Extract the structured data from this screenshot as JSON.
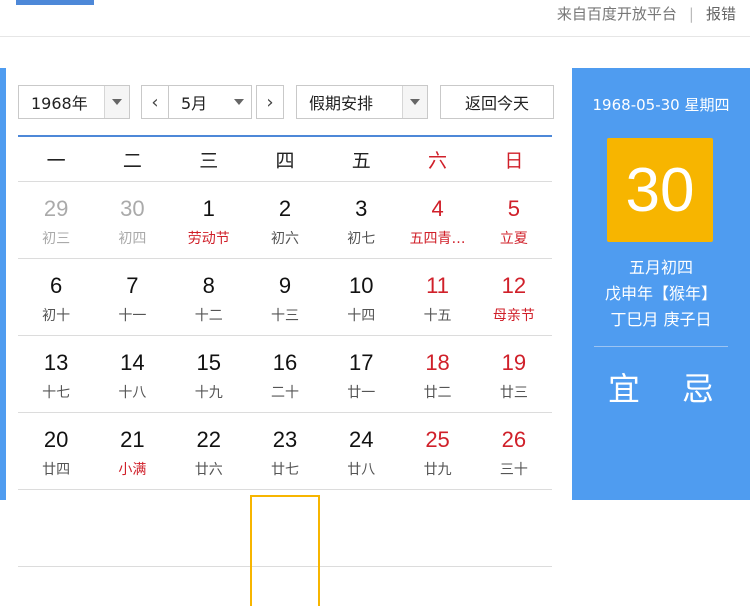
{
  "header": {
    "source_text": "来自百度开放平台",
    "separator": "|",
    "report_label": "报错"
  },
  "controls": {
    "year": "1968年",
    "prev_month_icon": "‹",
    "month": "5月",
    "next_month_icon": "›",
    "holiday": "假期安排",
    "today_button": "返回今天"
  },
  "weekdays": [
    "一",
    "二",
    "三",
    "四",
    "五",
    "六",
    "日"
  ],
  "weeks": [
    [
      {
        "num": "29",
        "lunar": "初三",
        "other": true
      },
      {
        "num": "30",
        "lunar": "初四",
        "other": true
      },
      {
        "num": "1",
        "lunar": "劳动节",
        "lunar_red": true
      },
      {
        "num": "2",
        "lunar": "初六"
      },
      {
        "num": "3",
        "lunar": "初七"
      },
      {
        "num": "4",
        "lunar": "五四青…",
        "num_red": true,
        "lunar_red": true
      },
      {
        "num": "5",
        "lunar": "立夏",
        "num_red": true,
        "lunar_red": true
      }
    ],
    [
      {
        "num": "6",
        "lunar": "初十"
      },
      {
        "num": "7",
        "lunar": "十一"
      },
      {
        "num": "8",
        "lunar": "十二"
      },
      {
        "num": "9",
        "lunar": "十三"
      },
      {
        "num": "10",
        "lunar": "十四"
      },
      {
        "num": "11",
        "lunar": "十五",
        "num_red": true
      },
      {
        "num": "12",
        "lunar": "母亲节",
        "num_red": true,
        "lunar_red": true
      }
    ],
    [
      {
        "num": "13",
        "lunar": "十七"
      },
      {
        "num": "14",
        "lunar": "十八"
      },
      {
        "num": "15",
        "lunar": "十九"
      },
      {
        "num": "16",
        "lunar": "二十"
      },
      {
        "num": "17",
        "lunar": "廿一"
      },
      {
        "num": "18",
        "lunar": "廿二",
        "num_red": true
      },
      {
        "num": "19",
        "lunar": "廿三",
        "num_red": true
      }
    ],
    [
      {
        "num": "20",
        "lunar": "廿四"
      },
      {
        "num": "21",
        "lunar": "小满",
        "lunar_red": true
      },
      {
        "num": "22",
        "lunar": "廿六"
      },
      {
        "num": "23",
        "lunar": "廿七"
      },
      {
        "num": "24",
        "lunar": "廿八"
      },
      {
        "num": "25",
        "lunar": "廿九",
        "num_red": true
      },
      {
        "num": "26",
        "lunar": "三十",
        "num_red": true
      }
    ],
    [
      {
        "num": "",
        "lunar": ""
      },
      {
        "num": "",
        "lunar": ""
      },
      {
        "num": "",
        "lunar": ""
      },
      {
        "num": "",
        "lunar": "",
        "selected": true
      },
      {
        "num": "",
        "lunar": ""
      },
      {
        "num": "",
        "lunar": ""
      },
      {
        "num": "",
        "lunar": ""
      }
    ]
  ],
  "side": {
    "date_line": "1968-05-30 星期四",
    "big_day": "30",
    "lunar_date": "五月初四",
    "ganzhi_year": "戊申年【猴年】",
    "ganzhi_month_day": "丁巳月 庚子日",
    "yi": "宜",
    "ji": "忌"
  },
  "colors": {
    "panel_blue": "#4f9cf0",
    "highlight": "#f7b500",
    "holiday_red": "#d0202a"
  }
}
